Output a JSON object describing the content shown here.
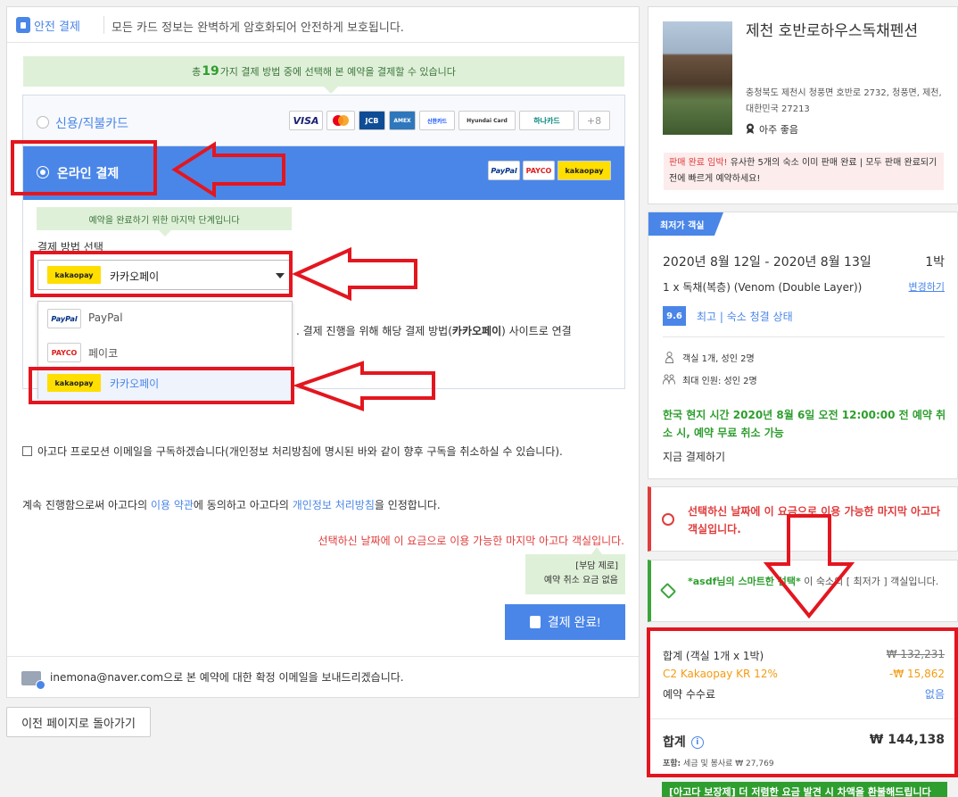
{
  "payment": {
    "secure_label": "안전 결제",
    "secure_text": "모든 카드 정보는 완벽하게 암호화되어 안전하게 보호됩니다.",
    "methods_prefix": "총 ",
    "methods_count": "19",
    "methods_suffix": "가지 결제 방법 중에 선택해 본 예약을 결제할 수 있습니다",
    "card_label": "신용/직불카드",
    "card_logos": [
      "VISA",
      "MC",
      "JCB",
      "AMEX",
      "신한카드",
      "Hyundai Card",
      "하나카드"
    ],
    "card_more": "+8",
    "online_label": "온라인 결제",
    "online_logos": [
      "PayPal",
      "PAYCO",
      "kakaopay"
    ],
    "step_notice": "예약을 완료하기 위한 마지막 단계입니다",
    "method_select_label": "결제 방법 선택",
    "selected_method": "카카오페이",
    "selected_logo": "kakaopay",
    "dropdown": [
      {
        "logo": "PayPal",
        "label": "PayPal"
      },
      {
        "logo": "PAYCO",
        "label": "페이코"
      },
      {
        "logo": "kakaopay",
        "label": "카카오페이"
      }
    ],
    "redirect_pre": ". 결제 진행을 위해 해당 결제 방법(",
    "redirect_bold": "카카오페이",
    "redirect_post": ") 사이트로 연결",
    "promo_text": "아고다 프로모션 이메일을 구독하겠습니다(개인정보 처리방침에 명시된 바와 같이 향후 구독을 취소하실 수 있습니다).",
    "terms_pre": "계속 진행함으로써 아고다의 ",
    "terms_link1": "이용 약관",
    "terms_mid": "에 동의하고 아고다의 ",
    "terms_link2": "개인정보 처리방침",
    "terms_post": "을 인정합니다.",
    "last_room": "선택하신 날짜에 이 요금으로 이용 가능한 마지막 아고다 객실입니다.",
    "zero_title": "[부담 제로]",
    "zero_text": "예약 취소 요금 없음",
    "complete_button": "결제 완료!",
    "email_notice": "inemona@naver.com으로 본 예약에 대한 확정 이메일을 보내드리겠습니다.",
    "back_button": "이전 페이지로 돌아가기"
  },
  "hotel": {
    "name": "제천 호반로하우스독채펜션",
    "address": "충청북도 제천시 청풍면 호반로 2732, 청풍면, 제천, 대한민국 27213",
    "rating_word": "아주 좋음",
    "urgency_bold": "판매 완료 임박!",
    "urgency_text": " 유사한 5개의 숙소 이미 판매 완료 | 모두 판매 완료되기 전에 빠르게 예약하세요!"
  },
  "room": {
    "best_tag": "최저가 객실",
    "dates": "2020년 8월 12일 - 2020년 8월 13일",
    "nights": "1박",
    "room_type": "1 x 독채(복층) (Venom (Double Layer))",
    "change_link": "변경하기",
    "score": "9.6",
    "score_text": "최고 | 숙소 청결 상태",
    "guests": "객실 1개, 성인 2명",
    "max_guests": "최대 인원: 성인 2명",
    "cancel_policy": "한국 현지 시간 2020년 8월 6일 오전 12:00:00 전 예약 취소 시, 예약 무료 취소 가능",
    "pay_now": "지금 결제하기"
  },
  "alerts": {
    "red_text": "선택하신 날짜에 이 요금으로 이용 가능한 마지막 아고다 객실입니다.",
    "green_bold": "*asdf님의 스마트한 선택*",
    "green_text": " 이 숙소의 [ 최저가 ] 객실입니다."
  },
  "summary": {
    "subtotal_label": "합계 (객실 1개 x 1박)",
    "subtotal_value": "₩ 132,231",
    "discount_label": "C2 Kakaopay KR 12%",
    "discount_value": "-₩ 15,862",
    "fee_label": "예약 수수료",
    "fee_value": "없음",
    "total_label": "합계",
    "total_value": "₩ 144,138",
    "tax_label": "포함:",
    "tax_text": " 세금 및 봉사료 ₩ 27,769",
    "guarantee": "[아고다 보장제] 더 저렴한 요금 발견 시 차액을 환불해드립니다"
  },
  "colors": {
    "accent": "#4a86e8",
    "annotation_red": "#e3161f",
    "success_green": "#2e9e2e",
    "kakao_yellow": "#ffde00",
    "discount_orange": "#f39c12"
  }
}
